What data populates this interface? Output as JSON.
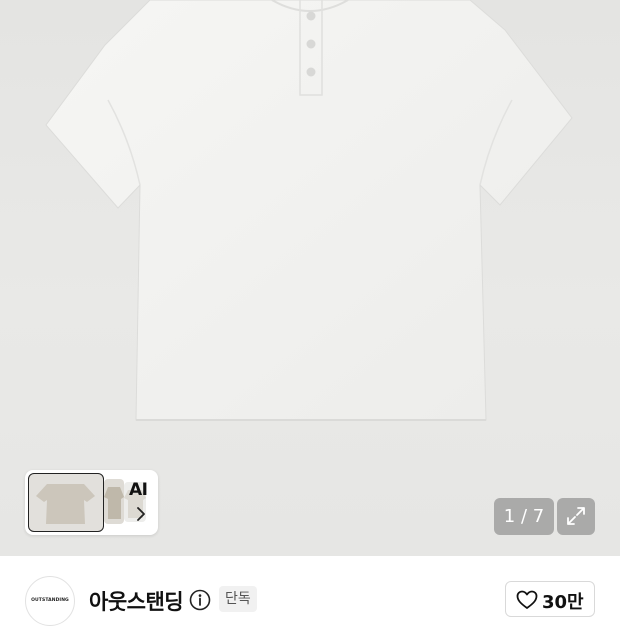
{
  "gallery": {
    "ai_label": "AI",
    "counter": "1 / 7"
  },
  "brand": {
    "logo_text": "OUTSTANDING",
    "name": "아웃스탠딩",
    "badge": "단독",
    "like_count": "30만"
  },
  "icons": {
    "ai_chevron": "chevron-right-icon",
    "fullscreen": "expand-icon",
    "info": "info-icon",
    "like": "heart-outline-icon"
  },
  "colors": {
    "garment": "#f3f3f1",
    "background": "#e7e7e5",
    "overlay": "#787878"
  }
}
